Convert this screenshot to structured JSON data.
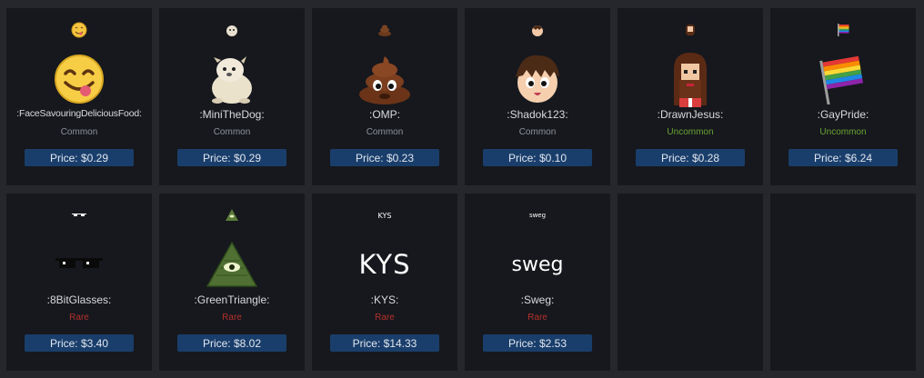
{
  "colors": {
    "common": "#8f9399",
    "uncommon": "#6aa333",
    "rare": "#b5302c"
  },
  "items": [
    {
      "name": ":FaceSavouringDeliciousFood:",
      "rarity": "Common",
      "rarity_color": "#8f9399",
      "price": "Price: $0.29",
      "icon": "face-savouring-food-icon"
    },
    {
      "name": ":MiniTheDog:",
      "rarity": "Common",
      "rarity_color": "#8f9399",
      "price": "Price: $0.29",
      "icon": "mini-the-dog-icon"
    },
    {
      "name": ":OMP:",
      "rarity": "Common",
      "rarity_color": "#8f9399",
      "price": "Price: $0.23",
      "icon": "poop-icon"
    },
    {
      "name": ":Shadok123:",
      "rarity": "Common",
      "rarity_color": "#8f9399",
      "price": "Price: $0.10",
      "icon": "shadok-face-icon"
    },
    {
      "name": ":DrawnJesus:",
      "rarity": "Uncommon",
      "rarity_color": "#6aa333",
      "price": "Price: $0.28",
      "icon": "drawn-jesus-icon"
    },
    {
      "name": ":GayPride:",
      "rarity": "Uncommon",
      "rarity_color": "#6aa333",
      "price": "Price: $6.24",
      "icon": "rainbow-flag-icon"
    },
    {
      "name": ":8BitGlasses:",
      "rarity": "Rare",
      "rarity_color": "#b5302c",
      "price": "Price: $3.40",
      "icon": "pixel-glasses-icon"
    },
    {
      "name": ":GreenTriangle:",
      "rarity": "Rare",
      "rarity_color": "#b5302c",
      "price": "Price: $8.02",
      "icon": "illuminati-triangle-icon"
    },
    {
      "name": ":KYS:",
      "rarity": "Rare",
      "rarity_color": "#b5302c",
      "price": "Price: $14.33",
      "icon": "kys-text-icon",
      "label": "KYS"
    },
    {
      "name": ":Sweg:",
      "rarity": "Rare",
      "rarity_color": "#b5302c",
      "price": "Price: $2.53",
      "icon": "sweg-text-icon",
      "label": "sweg"
    }
  ]
}
